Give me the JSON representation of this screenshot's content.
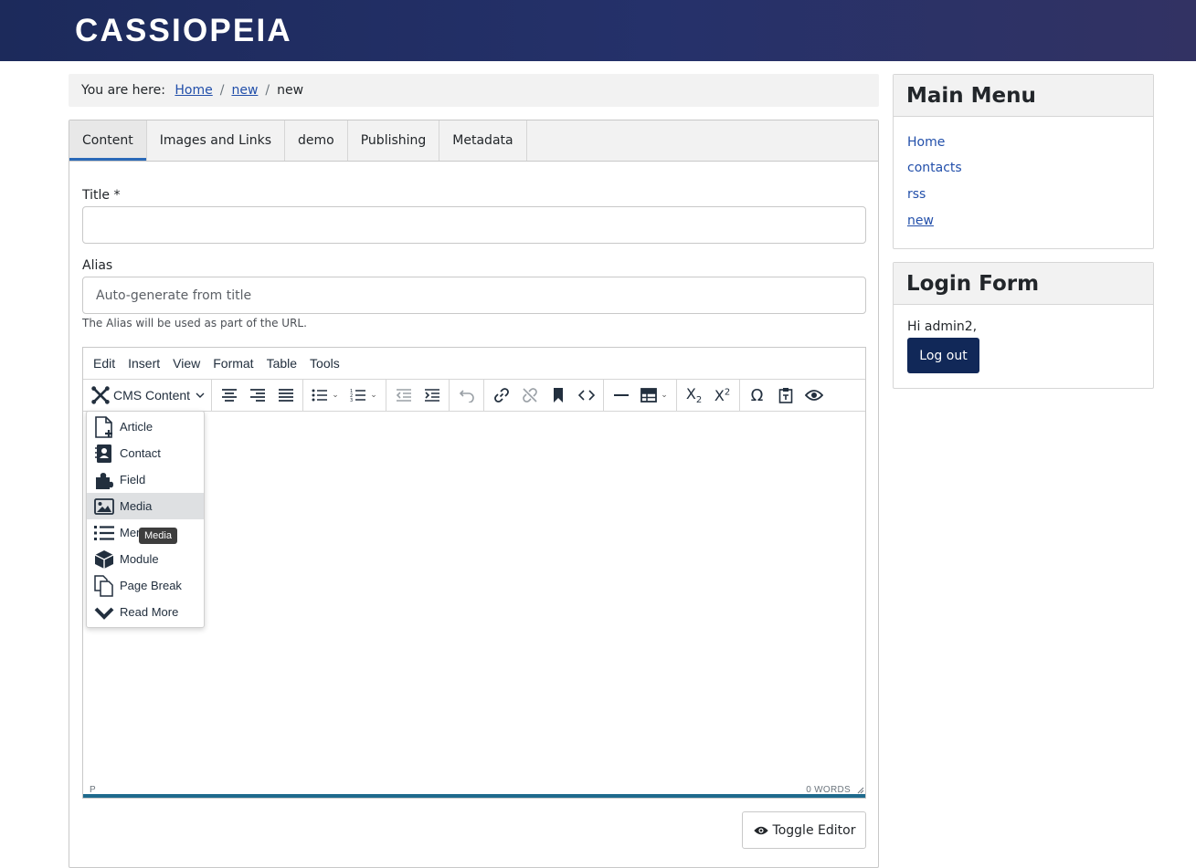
{
  "site": {
    "brand": "CASSIOPEIA"
  },
  "breadcrumb": {
    "prefix": "You are here:",
    "items": [
      "Home",
      "new",
      "new"
    ]
  },
  "tabs": [
    "Content",
    "Images and Links",
    "demo",
    "Publishing",
    "Metadata"
  ],
  "form": {
    "title_label": "Title *",
    "title_value": "",
    "alias_label": "Alias",
    "alias_placeholder": "Auto-generate from title",
    "alias_hint": "The Alias will be used as part of the URL."
  },
  "editor": {
    "menubar": [
      "Edit",
      "Insert",
      "View",
      "Format",
      "Table",
      "Tools"
    ],
    "cms_button_label": "CMS Content",
    "status_path": "P",
    "word_count": "0 WORDS",
    "dropdown_items": [
      {
        "label": "Article",
        "icon": "file-plus-icon"
      },
      {
        "label": "Contact",
        "icon": "address-book-icon"
      },
      {
        "label": "Field",
        "icon": "puzzle-icon"
      },
      {
        "label": "Media",
        "icon": "image-icon"
      },
      {
        "label": "Menu",
        "icon": "list-icon"
      },
      {
        "label": "Module",
        "icon": "cube-icon"
      },
      {
        "label": "Page Break",
        "icon": "copy-icon"
      },
      {
        "label": "Read More",
        "icon": "chevron-down-icon"
      }
    ],
    "hovered_item": "Media",
    "tooltip": "Media",
    "toggle_label": "Toggle Editor"
  },
  "sidebar": {
    "main_menu": {
      "title": "Main Menu",
      "items": [
        "Home",
        "contacts",
        "rss",
        "new"
      ],
      "current": "new"
    },
    "login": {
      "title": "Login Form",
      "greeting": "Hi admin2,",
      "logout_label": "Log out"
    }
  },
  "colors": {
    "header": "#1c2a5b",
    "link": "#224faa",
    "button": "#112858",
    "accent": "#1e6a8d"
  }
}
